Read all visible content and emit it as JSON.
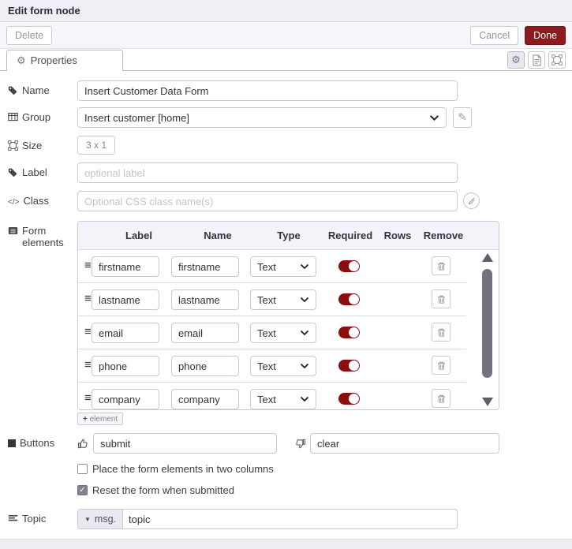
{
  "dialog": {
    "title": "Edit form node"
  },
  "toolbar": {
    "delete": "Delete",
    "cancel": "Cancel",
    "done": "Done"
  },
  "tabs": {
    "properties": "Properties"
  },
  "fields": {
    "name": {
      "label": "Name",
      "value": "Insert Customer Data Form"
    },
    "group": {
      "label": "Group",
      "value": "Insert customer [home]"
    },
    "size": {
      "label": "Size",
      "value": "3 x 1"
    },
    "optional_label": {
      "label": "Label",
      "placeholder": "optional label"
    },
    "css_class": {
      "label": "Class",
      "placeholder": "Optional CSS class name(s)"
    },
    "form_elements": {
      "label": "Form elements"
    },
    "buttons": {
      "label": "Buttons",
      "submit": "submit",
      "clear": "clear"
    },
    "topic": {
      "label": "Topic",
      "prop": "msg.",
      "value": "topic"
    }
  },
  "elements_table": {
    "headers": [
      "Label",
      "Name",
      "Type",
      "Required",
      "Rows",
      "Remove"
    ],
    "add_element": "element",
    "rows": [
      {
        "label": "firstname",
        "name": "firstname",
        "type": "Text",
        "required": true
      },
      {
        "label": "lastname",
        "name": "lastname",
        "type": "Text",
        "required": true
      },
      {
        "label": "email",
        "name": "email",
        "type": "Text",
        "required": true
      },
      {
        "label": "phone",
        "name": "phone",
        "type": "Text",
        "required": true
      },
      {
        "label": "company",
        "name": "company",
        "type": "Text",
        "required": true
      }
    ]
  },
  "options": [
    {
      "label": "Place the form elements in two columns",
      "checked": false
    },
    {
      "label": "Reset the form when submitted",
      "checked": true
    }
  ],
  "colors": {
    "accent_red": "#8c1a1f",
    "toggle_red": "#8b0e0e",
    "header_bg": "#eef0f5"
  }
}
